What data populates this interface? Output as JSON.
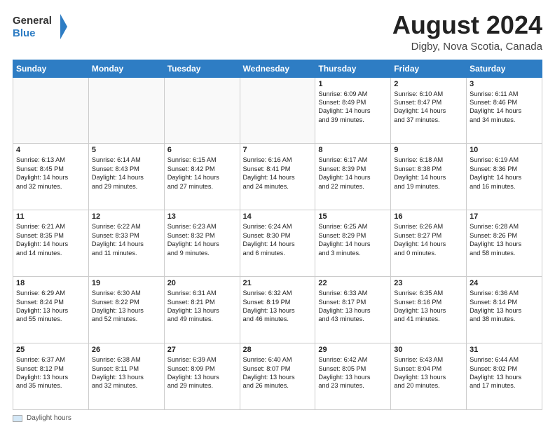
{
  "header": {
    "logo_line1": "General",
    "logo_line2": "Blue",
    "month_title": "August 2024",
    "location": "Digby, Nova Scotia, Canada"
  },
  "footer": {
    "label": "Daylight hours"
  },
  "weekdays": [
    "Sunday",
    "Monday",
    "Tuesday",
    "Wednesday",
    "Thursday",
    "Friday",
    "Saturday"
  ],
  "weeks": [
    [
      {
        "day": "",
        "info": ""
      },
      {
        "day": "",
        "info": ""
      },
      {
        "day": "",
        "info": ""
      },
      {
        "day": "",
        "info": ""
      },
      {
        "day": "1",
        "info": "Sunrise: 6:09 AM\nSunset: 8:49 PM\nDaylight: 14 hours\nand 39 minutes."
      },
      {
        "day": "2",
        "info": "Sunrise: 6:10 AM\nSunset: 8:47 PM\nDaylight: 14 hours\nand 37 minutes."
      },
      {
        "day": "3",
        "info": "Sunrise: 6:11 AM\nSunset: 8:46 PM\nDaylight: 14 hours\nand 34 minutes."
      }
    ],
    [
      {
        "day": "4",
        "info": "Sunrise: 6:13 AM\nSunset: 8:45 PM\nDaylight: 14 hours\nand 32 minutes."
      },
      {
        "day": "5",
        "info": "Sunrise: 6:14 AM\nSunset: 8:43 PM\nDaylight: 14 hours\nand 29 minutes."
      },
      {
        "day": "6",
        "info": "Sunrise: 6:15 AM\nSunset: 8:42 PM\nDaylight: 14 hours\nand 27 minutes."
      },
      {
        "day": "7",
        "info": "Sunrise: 6:16 AM\nSunset: 8:41 PM\nDaylight: 14 hours\nand 24 minutes."
      },
      {
        "day": "8",
        "info": "Sunrise: 6:17 AM\nSunset: 8:39 PM\nDaylight: 14 hours\nand 22 minutes."
      },
      {
        "day": "9",
        "info": "Sunrise: 6:18 AM\nSunset: 8:38 PM\nDaylight: 14 hours\nand 19 minutes."
      },
      {
        "day": "10",
        "info": "Sunrise: 6:19 AM\nSunset: 8:36 PM\nDaylight: 14 hours\nand 16 minutes."
      }
    ],
    [
      {
        "day": "11",
        "info": "Sunrise: 6:21 AM\nSunset: 8:35 PM\nDaylight: 14 hours\nand 14 minutes."
      },
      {
        "day": "12",
        "info": "Sunrise: 6:22 AM\nSunset: 8:33 PM\nDaylight: 14 hours\nand 11 minutes."
      },
      {
        "day": "13",
        "info": "Sunrise: 6:23 AM\nSunset: 8:32 PM\nDaylight: 14 hours\nand 9 minutes."
      },
      {
        "day": "14",
        "info": "Sunrise: 6:24 AM\nSunset: 8:30 PM\nDaylight: 14 hours\nand 6 minutes."
      },
      {
        "day": "15",
        "info": "Sunrise: 6:25 AM\nSunset: 8:29 PM\nDaylight: 14 hours\nand 3 minutes."
      },
      {
        "day": "16",
        "info": "Sunrise: 6:26 AM\nSunset: 8:27 PM\nDaylight: 14 hours\nand 0 minutes."
      },
      {
        "day": "17",
        "info": "Sunrise: 6:28 AM\nSunset: 8:26 PM\nDaylight: 13 hours\nand 58 minutes."
      }
    ],
    [
      {
        "day": "18",
        "info": "Sunrise: 6:29 AM\nSunset: 8:24 PM\nDaylight: 13 hours\nand 55 minutes."
      },
      {
        "day": "19",
        "info": "Sunrise: 6:30 AM\nSunset: 8:22 PM\nDaylight: 13 hours\nand 52 minutes."
      },
      {
        "day": "20",
        "info": "Sunrise: 6:31 AM\nSunset: 8:21 PM\nDaylight: 13 hours\nand 49 minutes."
      },
      {
        "day": "21",
        "info": "Sunrise: 6:32 AM\nSunset: 8:19 PM\nDaylight: 13 hours\nand 46 minutes."
      },
      {
        "day": "22",
        "info": "Sunrise: 6:33 AM\nSunset: 8:17 PM\nDaylight: 13 hours\nand 43 minutes."
      },
      {
        "day": "23",
        "info": "Sunrise: 6:35 AM\nSunset: 8:16 PM\nDaylight: 13 hours\nand 41 minutes."
      },
      {
        "day": "24",
        "info": "Sunrise: 6:36 AM\nSunset: 8:14 PM\nDaylight: 13 hours\nand 38 minutes."
      }
    ],
    [
      {
        "day": "25",
        "info": "Sunrise: 6:37 AM\nSunset: 8:12 PM\nDaylight: 13 hours\nand 35 minutes."
      },
      {
        "day": "26",
        "info": "Sunrise: 6:38 AM\nSunset: 8:11 PM\nDaylight: 13 hours\nand 32 minutes."
      },
      {
        "day": "27",
        "info": "Sunrise: 6:39 AM\nSunset: 8:09 PM\nDaylight: 13 hours\nand 29 minutes."
      },
      {
        "day": "28",
        "info": "Sunrise: 6:40 AM\nSunset: 8:07 PM\nDaylight: 13 hours\nand 26 minutes."
      },
      {
        "day": "29",
        "info": "Sunrise: 6:42 AM\nSunset: 8:05 PM\nDaylight: 13 hours\nand 23 minutes."
      },
      {
        "day": "30",
        "info": "Sunrise: 6:43 AM\nSunset: 8:04 PM\nDaylight: 13 hours\nand 20 minutes."
      },
      {
        "day": "31",
        "info": "Sunrise: 6:44 AM\nSunset: 8:02 PM\nDaylight: 13 hours\nand 17 minutes."
      }
    ]
  ]
}
